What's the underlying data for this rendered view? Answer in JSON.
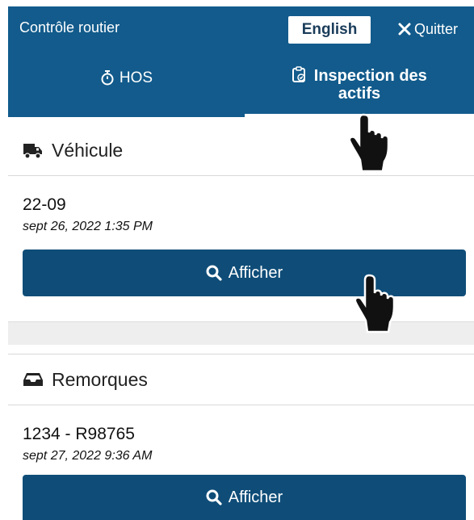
{
  "header": {
    "title": "Contrôle routier",
    "language_button": "English",
    "quit_label": "Quitter"
  },
  "tabs": [
    {
      "label": "HOS",
      "icon": "stopwatch-icon",
      "active": false
    },
    {
      "label_line1": "Inspection des",
      "label_line2": "actifs",
      "icon": "clipboard-check-icon",
      "active": true
    }
  ],
  "vehicle": {
    "section_title": "Véhicule",
    "icon": "truck-icon",
    "id": "22-09",
    "date": "sept 26, 2022 1:35 PM",
    "button_label": "Afficher"
  },
  "trailers": {
    "section_title": "Remorques",
    "icon": "inbox-icon",
    "id": "1234 - R98765",
    "date": "sept 27, 2022 9:36 AM",
    "button_label": "Afficher"
  },
  "colors": {
    "header_bg": "#125b8c",
    "button_bg": "#0f4d78",
    "band_bg": "#eeeeee"
  }
}
